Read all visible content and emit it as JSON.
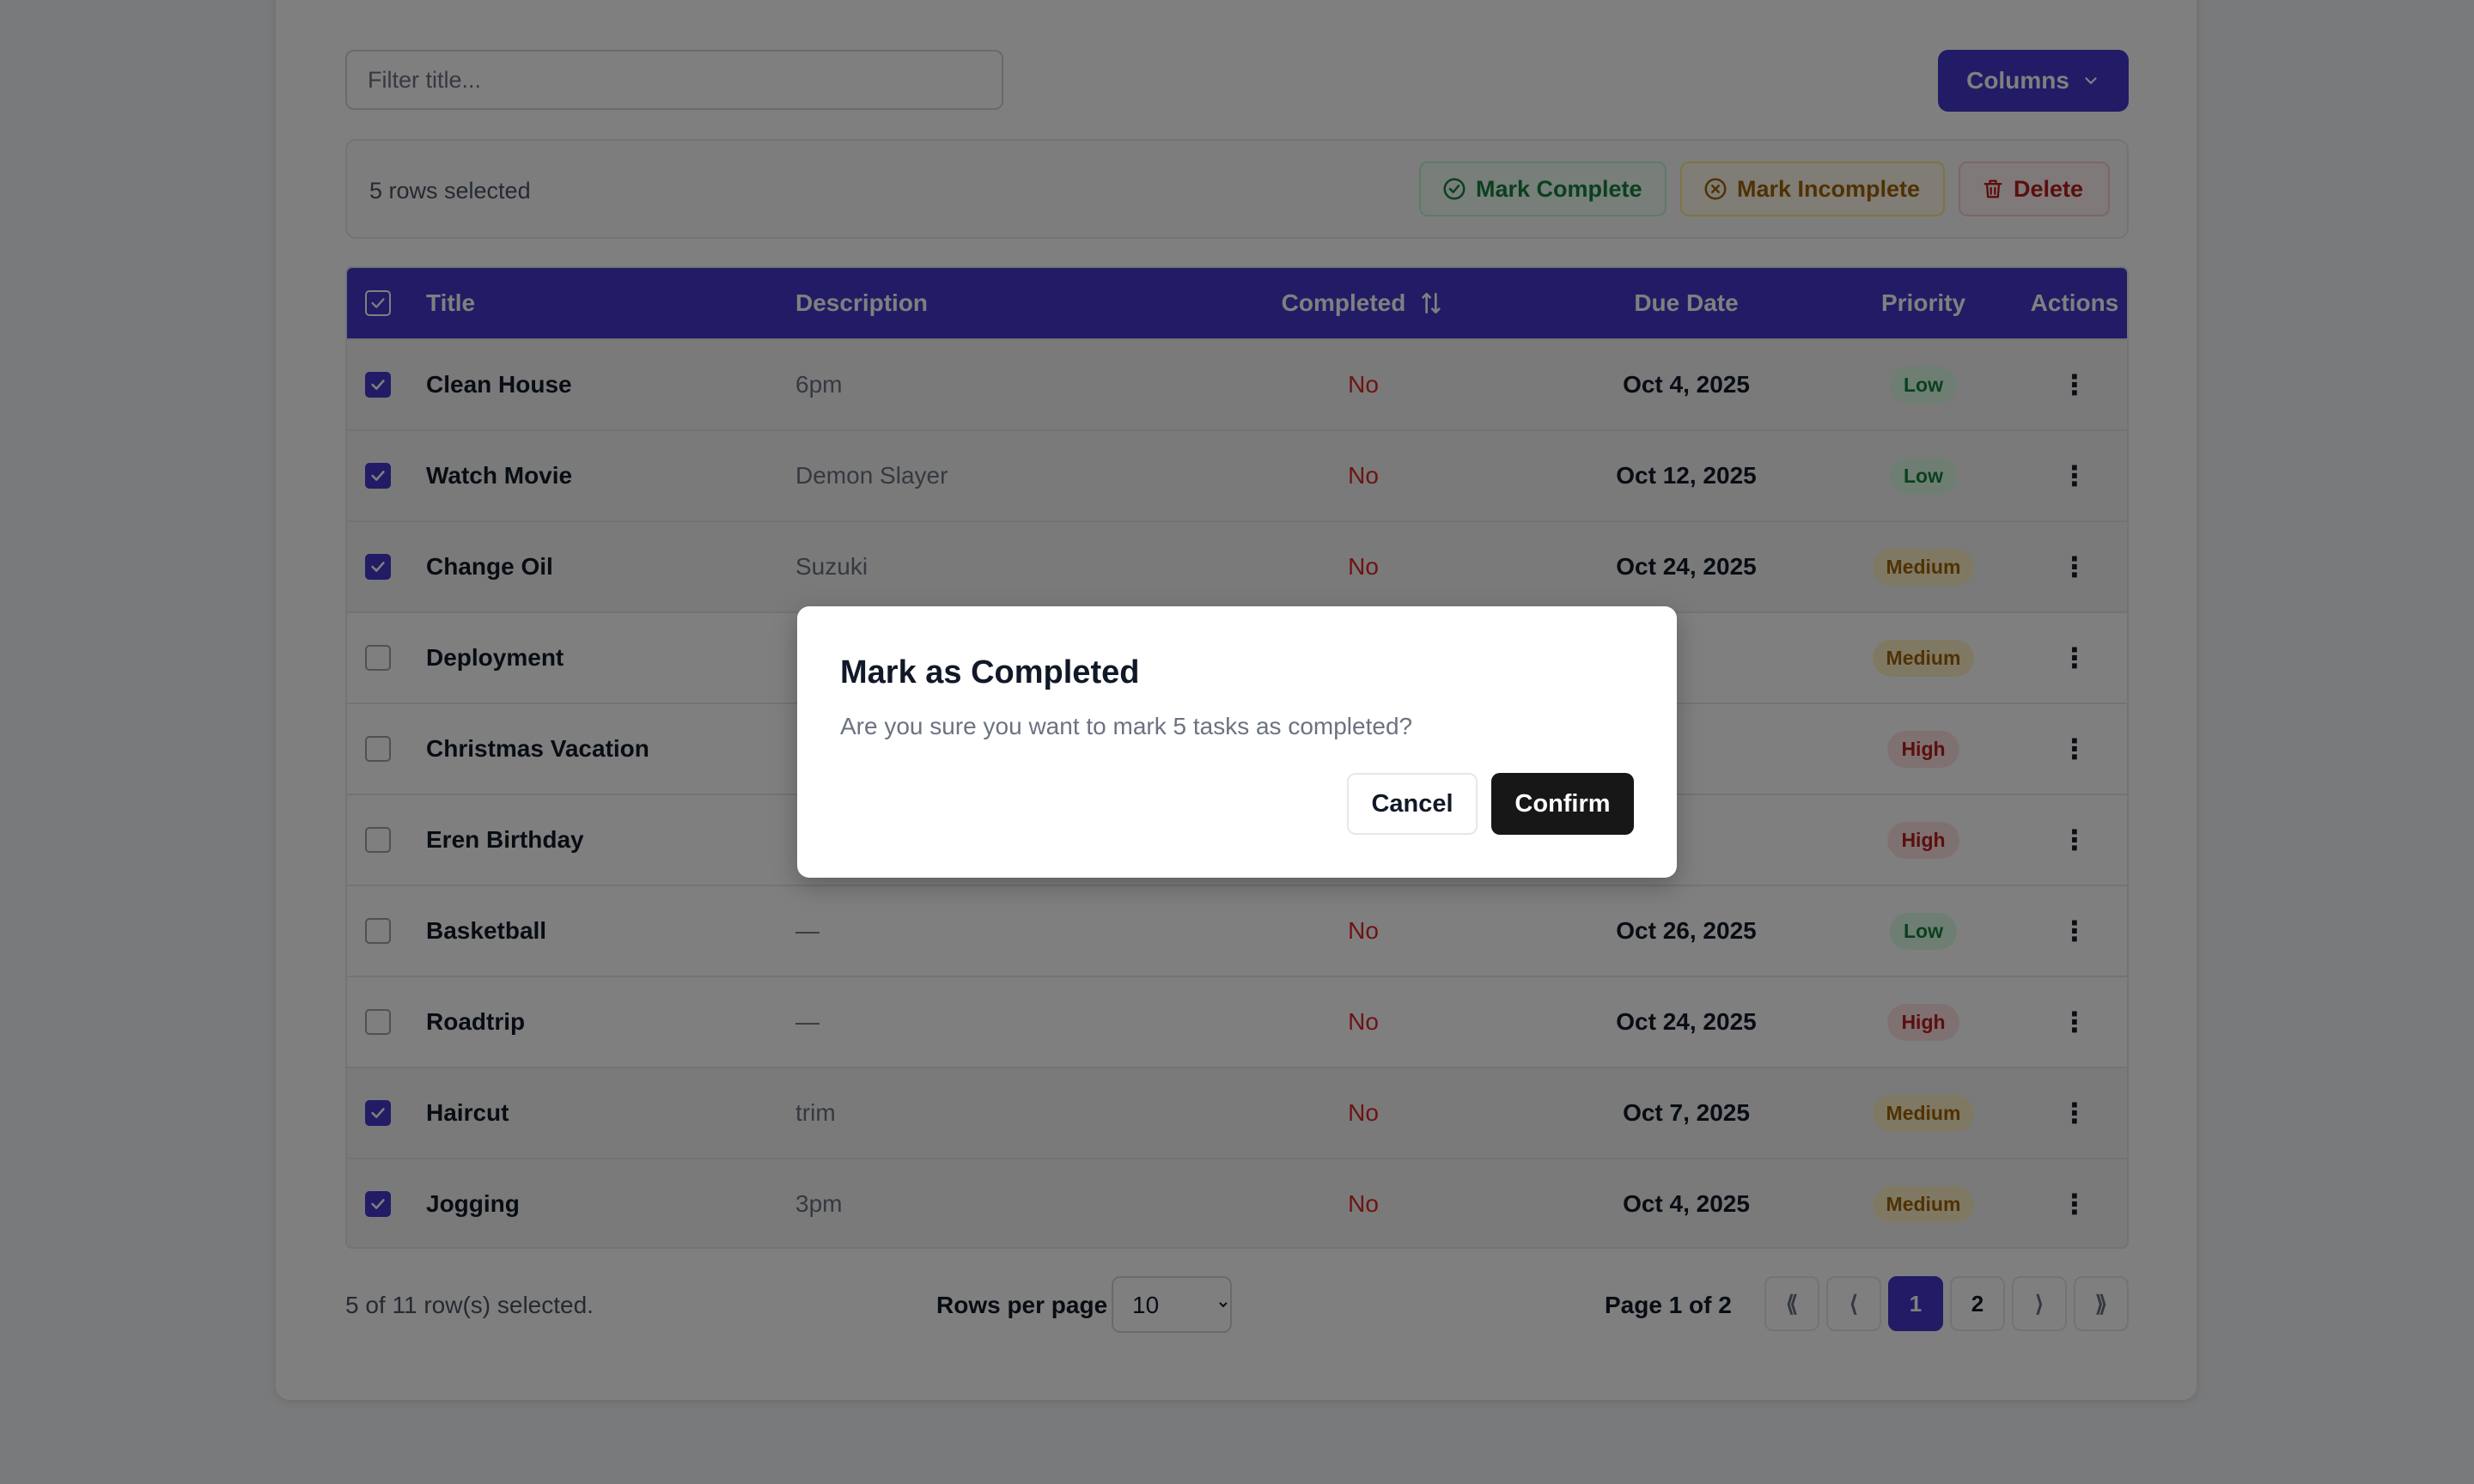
{
  "toolbar": {
    "filter_placeholder": "Filter title...",
    "columns_label": "Columns"
  },
  "bulk": {
    "selected_text": "5 rows selected",
    "mark_complete": "Mark Complete",
    "mark_incomplete": "Mark Incomplete",
    "delete": "Delete"
  },
  "table": {
    "headers": {
      "title": "Title",
      "description": "Description",
      "completed": "Completed",
      "due_date": "Due Date",
      "priority": "Priority",
      "actions": "Actions"
    },
    "rows": [
      {
        "selected": true,
        "title": "Clean House",
        "description": "6pm",
        "completed": "No",
        "due": "Oct 4, 2025",
        "priority": "Low"
      },
      {
        "selected": true,
        "title": "Watch Movie",
        "description": "Demon Slayer",
        "completed": "No",
        "due": "Oct 12, 2025",
        "priority": "Low"
      },
      {
        "selected": true,
        "title": "Change Oil",
        "description": "Suzuki",
        "completed": "No",
        "due": "Oct 24, 2025",
        "priority": "Medium"
      },
      {
        "selected": false,
        "title": "Deployment",
        "description": "",
        "completed": "",
        "due": "",
        "priority": "Medium"
      },
      {
        "selected": false,
        "title": "Christmas Vacation",
        "description": "",
        "completed": "",
        "due": "",
        "priority": "High"
      },
      {
        "selected": false,
        "title": "Eren Birthday",
        "description": "",
        "completed": "",
        "due": "",
        "priority": "High"
      },
      {
        "selected": false,
        "title": "Basketball",
        "description": "—",
        "completed": "No",
        "due": "Oct 26, 2025",
        "priority": "Low"
      },
      {
        "selected": false,
        "title": "Roadtrip",
        "description": "—",
        "completed": "No",
        "due": "Oct 24, 2025",
        "priority": "High"
      },
      {
        "selected": true,
        "title": "Haircut",
        "description": "trim",
        "completed": "No",
        "due": "Oct 7, 2025",
        "priority": "Medium"
      },
      {
        "selected": true,
        "title": "Jogging",
        "description": "3pm",
        "completed": "No",
        "due": "Oct 4, 2025",
        "priority": "Medium"
      }
    ]
  },
  "footer": {
    "selection_text": "5 of 11 row(s) selected.",
    "rows_per_page_label": "Rows per page",
    "rows_per_page_value": "10",
    "page_info": "Page 1 of 2",
    "first": "⟪",
    "prev": "⟨",
    "pages": [
      "1",
      "2"
    ],
    "next": "⟩",
    "last": "⟫"
  },
  "modal": {
    "title": "Mark as Completed",
    "description": "Are you sure you want to mark 5 tasks as completed?",
    "cancel": "Cancel",
    "confirm": "Confirm"
  },
  "icons": {
    "kebab": "⋮"
  },
  "colors": {
    "accent": "#4338ca",
    "no": "#dc2626",
    "low": "#15803d",
    "medium": "#a16207",
    "high": "#b91c1c"
  }
}
